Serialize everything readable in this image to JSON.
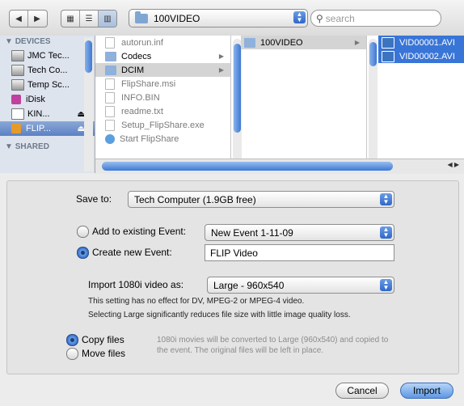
{
  "toolbar": {
    "back_icon": "back-arrow-icon",
    "forward_icon": "forward-arrow-icon",
    "view_modes": [
      "icon-view-icon",
      "list-view-icon",
      "column-view-icon"
    ],
    "path_label": "100VIDEO",
    "search_placeholder": "search"
  },
  "sidebar": {
    "devices_header": "DEVICES",
    "shared_header": "SHARED",
    "items": [
      {
        "label": "JMC Tec...",
        "eject": ""
      },
      {
        "label": "Tech Co...",
        "eject": ""
      },
      {
        "label": "Temp Sc...",
        "eject": ""
      },
      {
        "label": "iDisk",
        "eject": ""
      },
      {
        "label": "KIN...",
        "eject": "⏏"
      },
      {
        "label": "FLIP...",
        "eject": "⏏"
      }
    ]
  },
  "column1": [
    {
      "name": "autorun.inf",
      "type": "file",
      "greyed": true
    },
    {
      "name": "Codecs",
      "type": "folder",
      "greyed": false
    },
    {
      "name": "DCIM",
      "type": "folder",
      "greyed": false
    },
    {
      "name": "FlipShare.msi",
      "type": "file",
      "greyed": true
    },
    {
      "name": "INFO.BIN",
      "type": "file",
      "greyed": true
    },
    {
      "name": "readme.txt",
      "type": "file",
      "greyed": true
    },
    {
      "name": "Setup_FlipShare.exe",
      "type": "file",
      "greyed": true
    },
    {
      "name": "Start FlipShare",
      "type": "app",
      "greyed": true
    }
  ],
  "column2": [
    {
      "name": "100VIDEO",
      "type": "folder"
    }
  ],
  "column3": [
    {
      "name": "VID00001.AVI"
    },
    {
      "name": "VID00002.AVI"
    }
  ],
  "panel": {
    "save_to_label": "Save to:",
    "save_to_value": "Tech Computer (1.9GB free)",
    "add_existing_label": "Add to existing Event:",
    "existing_event_value": "New Event 1-11-09",
    "create_new_label": "Create new Event:",
    "new_event_value": "FLIP Video",
    "import_label": "Import 1080i video as:",
    "import_value": "Large - 960x540",
    "note1": "This setting has no effect for DV, MPEG-2 or MPEG-4 video.",
    "note2": "Selecting Large significantly reduces file size with little image quality loss.",
    "copy_files_label": "Copy files",
    "move_files_label": "Move files",
    "copy_note": "1080i movies will be converted to Large (960x540) and copied to the event. The original files will be left in place."
  },
  "buttons": {
    "cancel": "Cancel",
    "import": "Import"
  }
}
